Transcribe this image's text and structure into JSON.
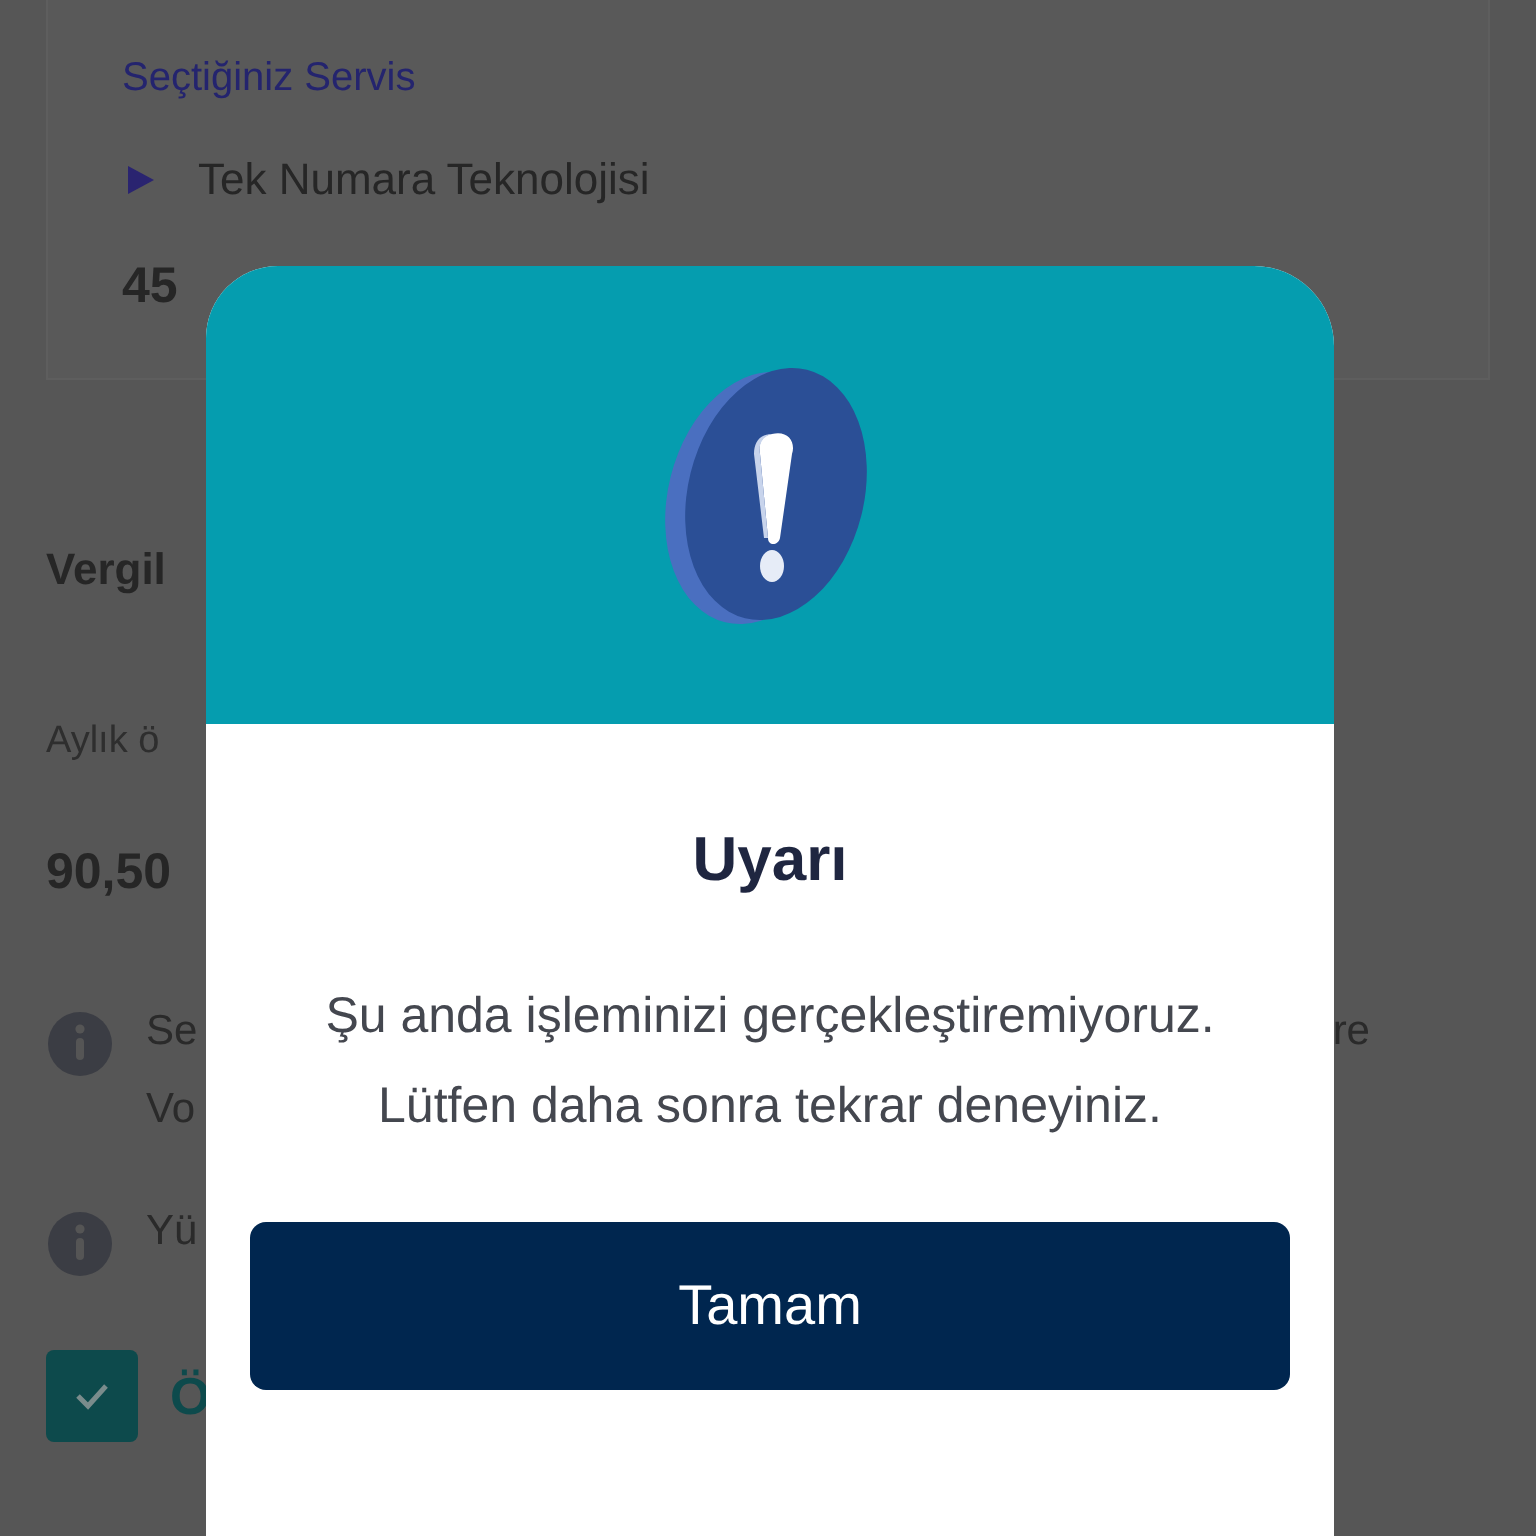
{
  "background": {
    "service_label": "Seçtiğiniz Servis",
    "service_name": "Tek Numara Teknolojisi",
    "service_amount": "45",
    "section_title": "Vergil",
    "monthly_label": "Aylık ö",
    "monthly_amount": "90,50",
    "notes": [
      {
        "start": [
          "Se",
          "Vo"
        ],
        "end": "re"
      },
      {
        "start": [
          "Yü"
        ]
      }
    ],
    "agreement": {
      "checked": true,
      "label": "Ö"
    }
  },
  "dialog": {
    "title": "Uyarı",
    "message": "Şu anda işleminizi gerçekleştiremiyoruz. Lütfen daha sonra tekrar deneyiniz.",
    "button": "Tamam"
  }
}
